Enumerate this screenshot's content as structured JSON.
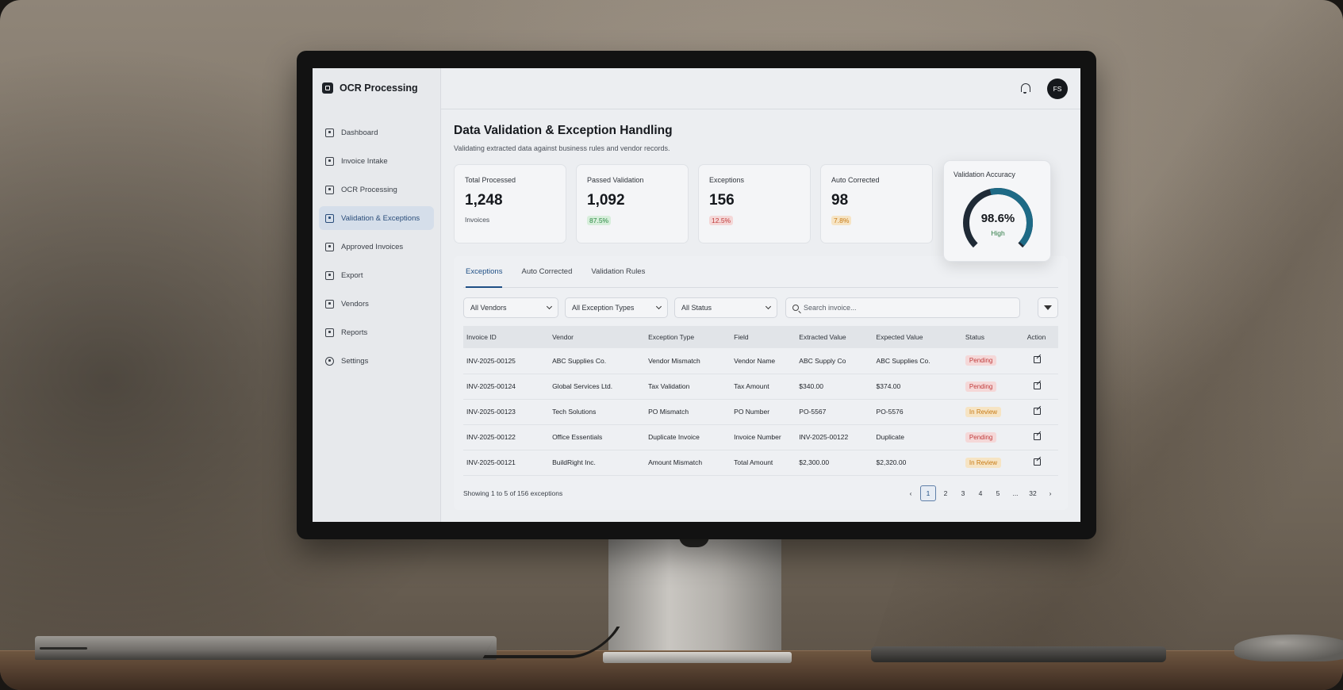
{
  "app": {
    "name": "OCR Processing"
  },
  "sidebar": {
    "items": [
      {
        "label": "Dashboard",
        "icon": "home-icon",
        "active": false
      },
      {
        "label": "Invoice Intake",
        "icon": "upload-icon",
        "active": false
      },
      {
        "label": "OCR Processing",
        "icon": "scan-icon",
        "active": false
      },
      {
        "label": "Validation & Exceptions",
        "icon": "shield-check-icon",
        "active": true
      },
      {
        "label": "Approved Invoices",
        "icon": "document-check-icon",
        "active": false
      },
      {
        "label": "Export",
        "icon": "export-icon",
        "active": false
      },
      {
        "label": "Vendors",
        "icon": "users-icon",
        "active": false
      },
      {
        "label": "Reports",
        "icon": "report-icon",
        "active": false
      },
      {
        "label": "Settings",
        "icon": "gear-icon",
        "active": false
      }
    ]
  },
  "header": {
    "avatar_initials": "FS",
    "notifications_icon": "bell-icon"
  },
  "page": {
    "title": "Data Validation & Exception Handling",
    "subtitle": "Validating extracted data against business rules and vendor records."
  },
  "kpis": [
    {
      "label": "Total Processed",
      "value": "1,248",
      "note": "Invoices",
      "tone": ""
    },
    {
      "label": "Passed Validation",
      "value": "1,092",
      "note": "87.5%",
      "tone": "green"
    },
    {
      "label": "Exceptions",
      "value": "156",
      "note": "12.5%",
      "tone": "red"
    },
    {
      "label": "Auto Corrected",
      "value": "98",
      "note": "7.8%",
      "tone": "amber"
    }
  ],
  "accuracy": {
    "label": "Validation Accuracy",
    "value": "98.6%",
    "fraction": 0.986,
    "status": "High",
    "colors": {
      "track": "#1f2a36",
      "fill": "#1e6a86"
    }
  },
  "tabs": [
    {
      "label": "Exceptions",
      "active": true
    },
    {
      "label": "Auto Corrected",
      "active": false
    },
    {
      "label": "Validation Rules",
      "active": false
    }
  ],
  "filters": {
    "vendors": "All Vendors",
    "exception_types": "All Exception Types",
    "status": "All Status",
    "search_placeholder": "Search invoice..."
  },
  "table": {
    "columns": [
      "Invoice ID",
      "Vendor",
      "Exception Type",
      "Field",
      "Extracted Value",
      "Expected Value",
      "Status",
      "Action"
    ],
    "rows": [
      {
        "id": "INV-2025-00125",
        "vendor": "ABC Supplies Co.",
        "type": "Vendor Mismatch",
        "field": "Vendor Name",
        "extracted": "ABC Supply Co",
        "expected": "ABC Supplies Co.",
        "status": "Pending",
        "status_tone": "pending"
      },
      {
        "id": "INV-2025-00124",
        "vendor": "Global Services Ltd.",
        "type": "Tax Validation",
        "field": "Tax Amount",
        "extracted": "$340.00",
        "expected": "$374.00",
        "status": "Pending",
        "status_tone": "pending"
      },
      {
        "id": "INV-2025-00123",
        "vendor": "Tech Solutions",
        "type": "PO Mismatch",
        "field": "PO Number",
        "extracted": "PO-5567",
        "expected": "PO-5576",
        "status": "In Review",
        "status_tone": "review"
      },
      {
        "id": "INV-2025-00122",
        "vendor": "Office Essentials",
        "type": "Duplicate Invoice",
        "field": "Invoice Number",
        "extracted": "INV-2025-00122",
        "expected": "Duplicate",
        "status": "Pending",
        "status_tone": "pending"
      },
      {
        "id": "INV-2025-00121",
        "vendor": "BuildRight Inc.",
        "type": "Amount Mismatch",
        "field": "Total Amount",
        "extracted": "$2,300.00",
        "expected": "$2,320.00",
        "status": "In Review",
        "status_tone": "review"
      }
    ]
  },
  "pagination": {
    "summary": "Showing 1 to 5 of 156 exceptions",
    "pages": [
      "1",
      "2",
      "3",
      "4",
      "5",
      "...",
      "32"
    ],
    "current": "1",
    "prev": "‹",
    "next": "›"
  }
}
